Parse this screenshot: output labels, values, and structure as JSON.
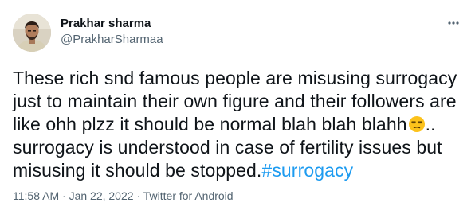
{
  "author": {
    "display_name": "Prakhar sharma",
    "handle": "@PrakharSharmaa",
    "avatar_icon": "profile-photo"
  },
  "more_icon": "more-horizontal-icon",
  "tweet": {
    "line1": "These rich snd famous people are misusing surrogacy",
    "line2": "just to maintain their own figure and their followers are",
    "line3_text": "like ohh plzz it should be normal blah blah blahh",
    "line3_tail": "..",
    "emoji": "unamused-face-emoji",
    "line4": "surrogacy is understood in case of fertility issues but",
    "line5_text": "misusing it should be stopped.",
    "hashtag": "#surrogacy"
  },
  "meta": {
    "time": "11:58 AM",
    "separator1": " · ",
    "date": "Jan 22, 2022",
    "separator2": " · ",
    "source": "Twitter for Android"
  },
  "colors": {
    "text": "#0f1419",
    "secondary": "#536471",
    "link": "#1d9bf0"
  }
}
